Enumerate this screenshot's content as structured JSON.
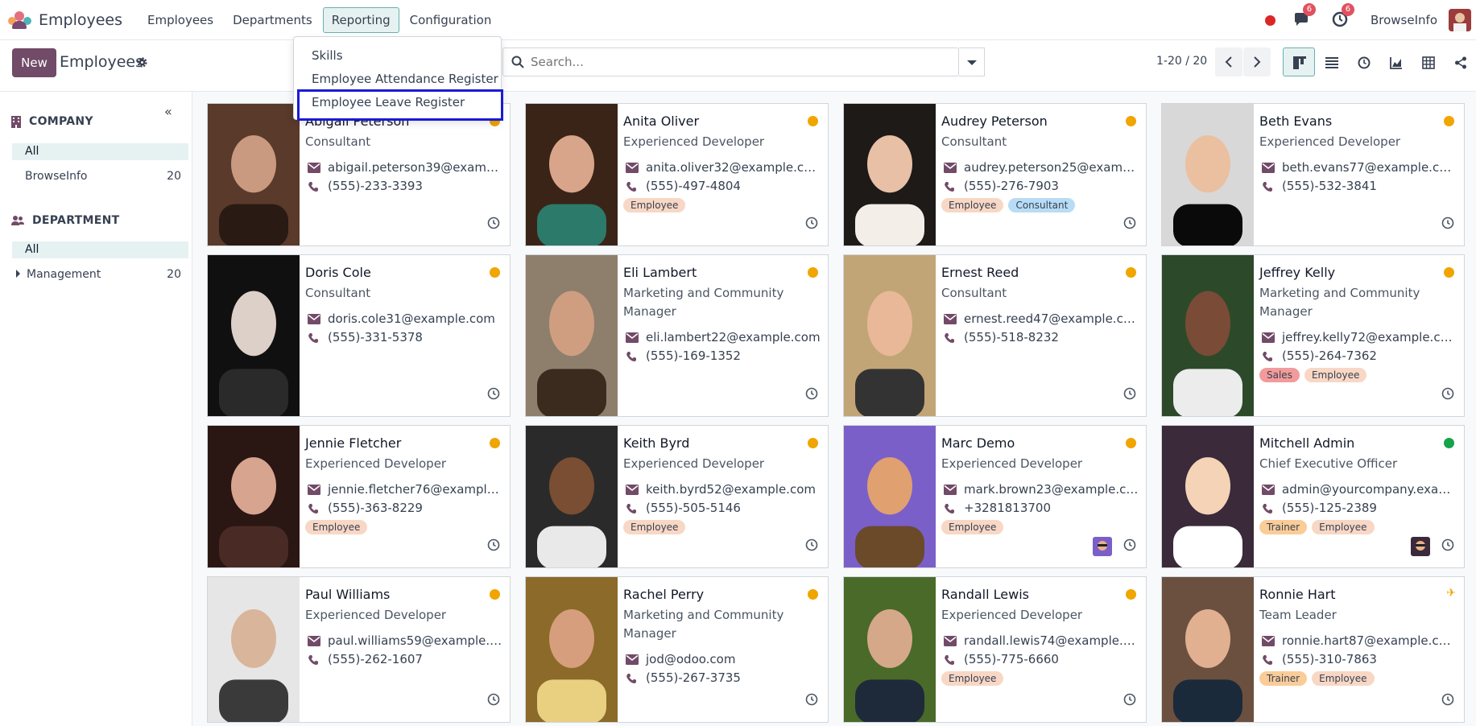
{
  "app": {
    "title": "Employees",
    "menu": [
      "Employees",
      "Departments",
      "Reporting",
      "Configuration"
    ],
    "active_menu": "Reporting",
    "company": "BrowseInfo",
    "messages_badge": "6",
    "activities_badge": "6"
  },
  "control": {
    "new_label": "New",
    "page_title": "Employees",
    "search_placeholder": "Search...",
    "pager": "1-20 / 20"
  },
  "dropdown": {
    "items": [
      "Skills",
      "Employee Attendance Register",
      "Employee Leave Register"
    ],
    "highlighted": "Employee Leave Register"
  },
  "sidebar": {
    "company_heading": "COMPANY",
    "company_all": "All",
    "company_items": [
      {
        "label": "BrowseInfo",
        "count": "20"
      }
    ],
    "department_heading": "DEPARTMENT",
    "department_all": "All",
    "department_items": [
      {
        "label": "Management",
        "count": "20"
      }
    ]
  },
  "employees": [
    {
      "name": "Abigail Peterson",
      "job": "Consultant",
      "email": "abigail.peterson39@exampl…",
      "phone": "(555)-233-3393",
      "tags": [],
      "status": "away"
    },
    {
      "name": "Anita Oliver",
      "job": "Experienced Developer",
      "email": "anita.oliver32@example.com",
      "phone": "(555)-497-4804",
      "tags": [
        "Employee"
      ],
      "status": "away"
    },
    {
      "name": "Audrey Peterson",
      "job": "Consultant",
      "email": "audrey.peterson25@exampl…",
      "phone": "(555)-276-7903",
      "tags": [
        "Employee",
        "Consultant"
      ],
      "status": "away"
    },
    {
      "name": "Beth Evans",
      "job": "Experienced Developer",
      "email": "beth.evans77@example.com",
      "phone": "(555)-532-3841",
      "tags": [],
      "status": "away"
    },
    {
      "name": "Doris Cole",
      "job": "Consultant",
      "email": "doris.cole31@example.com",
      "phone": "(555)-331-5378",
      "tags": [],
      "status": "away"
    },
    {
      "name": "Eli Lambert",
      "job": "Marketing and Community Manager",
      "email": "eli.lambert22@example.com",
      "phone": "(555)-169-1352",
      "tags": [],
      "status": "away"
    },
    {
      "name": "Ernest Reed",
      "job": "Consultant",
      "email": "ernest.reed47@example.com",
      "phone": "(555)-518-8232",
      "tags": [],
      "status": "away"
    },
    {
      "name": "Jeffrey Kelly",
      "job": "Marketing and Community Manager",
      "email": "jeffrey.kelly72@example.com",
      "phone": "(555)-264-7362",
      "tags": [
        "Sales",
        "Employee"
      ],
      "status": "away"
    },
    {
      "name": "Jennie Fletcher",
      "job": "Experienced Developer",
      "email": "jennie.fletcher76@example.…",
      "phone": "(555)-363-8229",
      "tags": [
        "Employee"
      ],
      "status": "away"
    },
    {
      "name": "Keith Byrd",
      "job": "Experienced Developer",
      "email": "keith.byrd52@example.com",
      "phone": "(555)-505-5146",
      "tags": [
        "Employee"
      ],
      "status": "away"
    },
    {
      "name": "Marc Demo",
      "job": "Experienced Developer",
      "email": "mark.brown23@example.com",
      "phone": "+3281813700",
      "tags": [
        "Employee"
      ],
      "status": "away"
    },
    {
      "name": "Mitchell Admin",
      "job": "Chief Executive Officer",
      "email": "admin@yourcompany.exam…",
      "phone": "(555)-125-2389",
      "tags": [
        "Trainer",
        "Employee"
      ],
      "status": "online"
    },
    {
      "name": "Paul Williams",
      "job": "Experienced Developer",
      "email": "paul.williams59@example.com",
      "phone": "(555)-262-1607",
      "tags": [],
      "status": "away"
    },
    {
      "name": "Rachel Perry",
      "job": "Marketing and Community Manager",
      "email": "jod@odoo.com",
      "phone": "(555)-267-3735",
      "tags": [],
      "status": "away"
    },
    {
      "name": "Randall Lewis",
      "job": "Experienced Developer",
      "email": "randall.lewis74@example.com",
      "phone": "(555)-775-6660",
      "tags": [
        "Employee"
      ],
      "status": "away"
    },
    {
      "name": "Ronnie Hart",
      "job": "Team Leader",
      "email": "ronnie.hart87@example.com",
      "phone": "(555)-310-7863",
      "tags": [
        "Trainer",
        "Employee"
      ],
      "status": "leave"
    }
  ]
}
